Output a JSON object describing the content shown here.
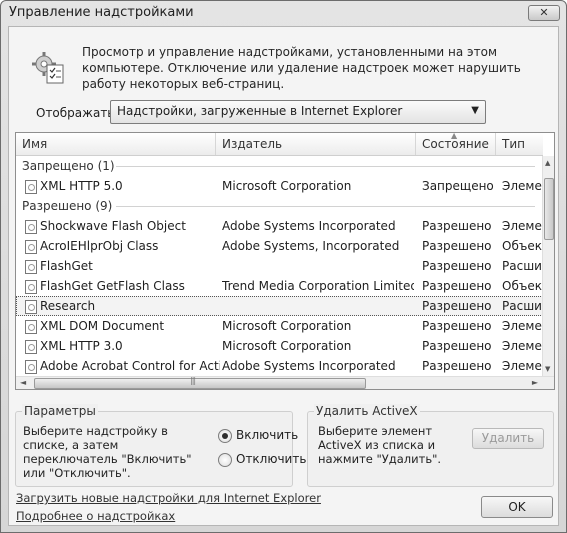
{
  "window": {
    "title": "Управление надстройками",
    "close_label": "✕"
  },
  "description": "Просмотр и управление надстройками, установленными на этом компьютере. Отключение или удаление надстроек может нарушить работу некоторых веб-страниц.",
  "show": {
    "label": "Отображать:",
    "selected": "Надстройки, загруженные в Internet Explorer"
  },
  "columns": [
    "Имя",
    "Издатель",
    "Состояние",
    "Тип"
  ],
  "groups": [
    {
      "label": "Запрещено (1)",
      "rows": [
        {
          "name": "XML HTTP 5.0",
          "publisher": "Microsoft Corporation",
          "state": "Запрещено",
          "type": "Элемент ActiveX"
        }
      ]
    },
    {
      "label": "Разрешено (9)",
      "rows": [
        {
          "name": "Shockwave Flash Object",
          "publisher": "Adobe Systems Incorporated",
          "state": "Разрешено",
          "type": "Элемент ActiveX"
        },
        {
          "name": "AcroIEHlprObj Class",
          "publisher": "Adobe Systems, Incorporated",
          "state": "Разрешено",
          "type": "Объект модуля поддержки"
        },
        {
          "name": "FlashGet",
          "publisher": "",
          "state": "Разрешено",
          "type": "Расширение обозревателя"
        },
        {
          "name": "FlashGet GetFlash Class",
          "publisher": "Trend Media Corporation Limited",
          "state": "Разрешено",
          "type": "Объект модуля поддержки"
        },
        {
          "name": "Research",
          "publisher": "",
          "state": "Разрешено",
          "type": "Расширение обозревателя",
          "selected": true
        },
        {
          "name": "XML DOM Document",
          "publisher": "Microsoft Corporation",
          "state": "Разрешено",
          "type": "Элемент ActiveX"
        },
        {
          "name": "XML HTTP 3.0",
          "publisher": "Microsoft Corporation",
          "state": "Разрешено",
          "type": "Элемент ActiveX"
        },
        {
          "name": "Adobe Acrobat Control for ActiveX",
          "publisher": "Adobe Systems Incorporated",
          "state": "Разрешено",
          "type": "Элемент ActiveX"
        }
      ]
    }
  ],
  "params": {
    "title": "Параметры",
    "text": "Выберите надстройку в списке, а затем переключатель \"Включить\" или \"Отключить\".",
    "enable": "Включить",
    "disable": "Отключить",
    "selected": "enable"
  },
  "activex": {
    "title": "Удалить ActiveX",
    "text": "Выберите элемент ActiveX из списка и нажмите \"Удалить\".",
    "remove": "Удалить"
  },
  "links": {
    "download": "Загрузить новые надстройки для Internet Explorer",
    "more": "Подробнее о надстройках"
  },
  "ok": "OK"
}
